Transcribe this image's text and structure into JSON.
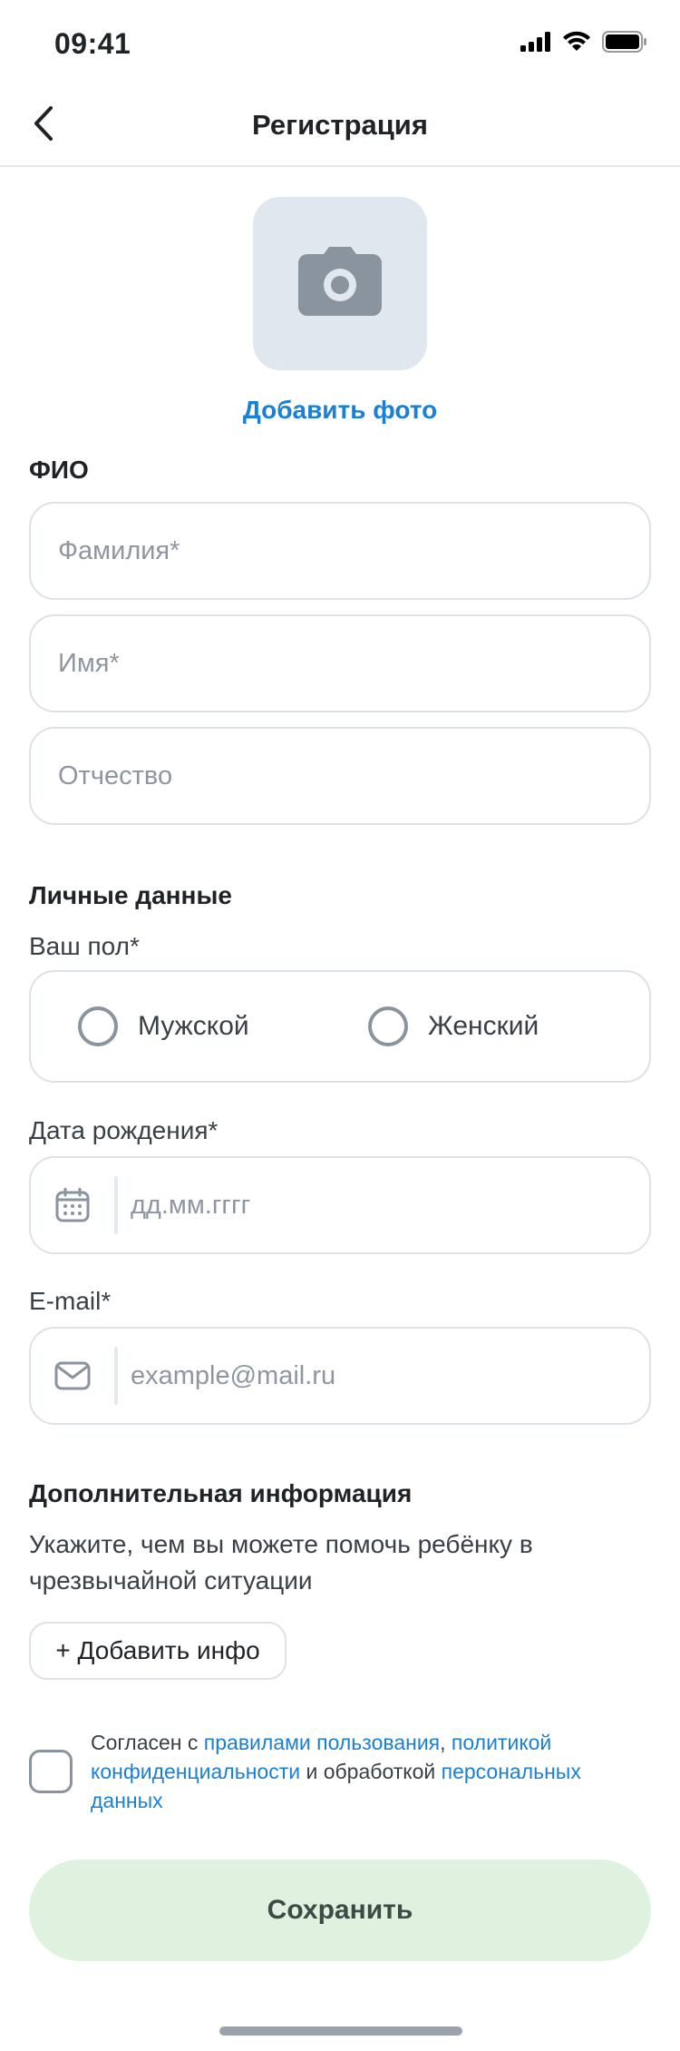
{
  "status_bar": {
    "time": "09:41",
    "icons": [
      "signal-icon",
      "wifi-icon",
      "battery-icon"
    ]
  },
  "nav": {
    "title": "Регистрация",
    "back_icon": "chevron-left-icon"
  },
  "photo": {
    "icon": "camera-icon",
    "add_label": "Добавить фото"
  },
  "fio": {
    "title": "ФИО",
    "surname_placeholder": "Фамилия*",
    "name_placeholder": "Имя*",
    "patronymic_placeholder": "Отчество"
  },
  "personal": {
    "title": "Личные данные",
    "gender_label": "Ваш пол*",
    "gender_options": [
      "Мужской",
      "Женский"
    ],
    "birth_label": "Дата рождения*",
    "birth_placeholder": "дд.мм.гггг",
    "email_label": "E-mail*",
    "email_placeholder": "example@mail.ru"
  },
  "additional": {
    "title": "Дополнительная информация",
    "description": "Укажите, чем вы можете помочь ребёнку в чрезвычайной ситуации",
    "add_button": "+ Добавить инфо"
  },
  "agreement": {
    "prefix": "Согласен с ",
    "link_terms": "правилами пользования",
    "comma": ", ",
    "link_privacy": "политикой конфиденциальности",
    "middle": " и обработкой ",
    "link_personal": "персональных данных"
  },
  "save_button": "Сохранить",
  "colors": {
    "accent": "#1a7fd6",
    "save_bg": "#dff2df",
    "border": "#dde2e9",
    "photo_bg": "#e1e7ef"
  }
}
